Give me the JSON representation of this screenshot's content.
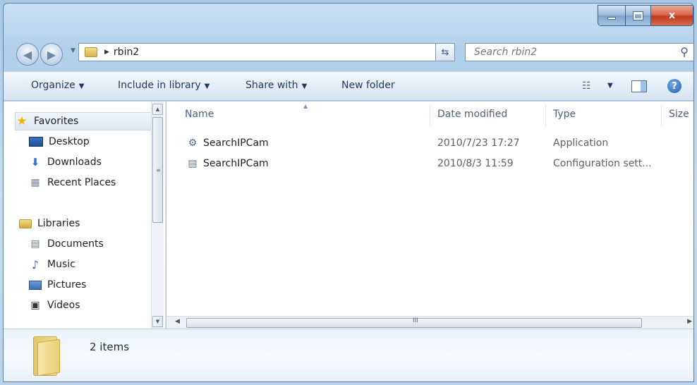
{
  "window": {
    "caption_min": "",
    "caption_max": "",
    "caption_close": "x"
  },
  "address": {
    "crumb": "rbin2",
    "search_placeholder": "Search rbin2"
  },
  "toolbar": {
    "organize": "Organize",
    "include_in_library": "Include in library",
    "share_with": "Share with",
    "new_folder": "New folder",
    "help": "?"
  },
  "navpane": {
    "favorites": {
      "label": "Favorites",
      "items": [
        "Desktop",
        "Downloads",
        "Recent Places"
      ]
    },
    "libraries": {
      "label": "Libraries",
      "items": [
        "Documents",
        "Music",
        "Pictures",
        "Videos"
      ]
    }
  },
  "columns": {
    "name": "Name",
    "date": "Date modified",
    "type": "Type",
    "size": "Size"
  },
  "files": [
    {
      "name": "SearchIPCam",
      "date": "2010/7/23 17:27",
      "type": "Application",
      "icon": "application-icon"
    },
    {
      "name": "SearchIPCam",
      "date": "2010/8/3 11:59",
      "type": "Configuration sett...",
      "icon": "config-file-icon"
    }
  ],
  "scroll_h_grip": "III",
  "details": {
    "item_count": "2 items"
  },
  "colors": {
    "accent": "#1e395b",
    "close": "#c0391c",
    "chrome": "#b3d0ea"
  }
}
